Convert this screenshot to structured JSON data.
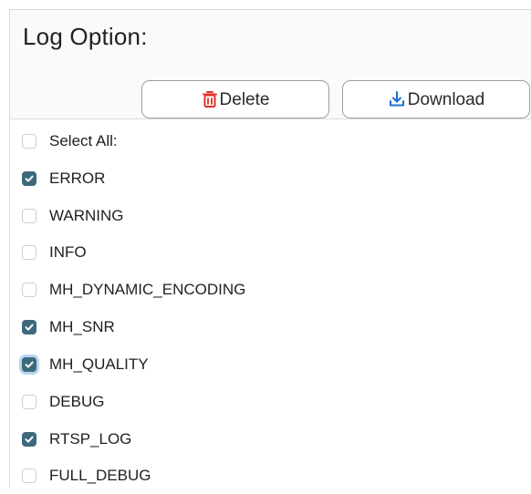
{
  "panel": {
    "title": "Log Option:"
  },
  "toolbar": {
    "delete_label": "Delete",
    "download_label": "Download",
    "delete_icon": "trash-icon",
    "download_icon": "download-icon",
    "delete_icon_color": "#e0302b",
    "download_icon_color": "#1f6fd1"
  },
  "select_all": {
    "label": "Select All:",
    "checked": false
  },
  "options": [
    {
      "label": "ERROR",
      "checked": true
    },
    {
      "label": "WARNING",
      "checked": false
    },
    {
      "label": "INFO",
      "checked": false
    },
    {
      "label": "MH_DYNAMIC_ENCODING",
      "checked": false
    },
    {
      "label": "MH_SNR",
      "checked": true
    },
    {
      "label": "MH_QUALITY",
      "checked": true,
      "focused": true
    },
    {
      "label": "DEBUG",
      "checked": false
    },
    {
      "label": "RTSP_LOG",
      "checked": true
    },
    {
      "label": "FULL_DEBUG",
      "checked": false
    }
  ],
  "colors": {
    "checkbox_checked": "#3c6a7a",
    "focus_ring": "#bcd3f2"
  }
}
